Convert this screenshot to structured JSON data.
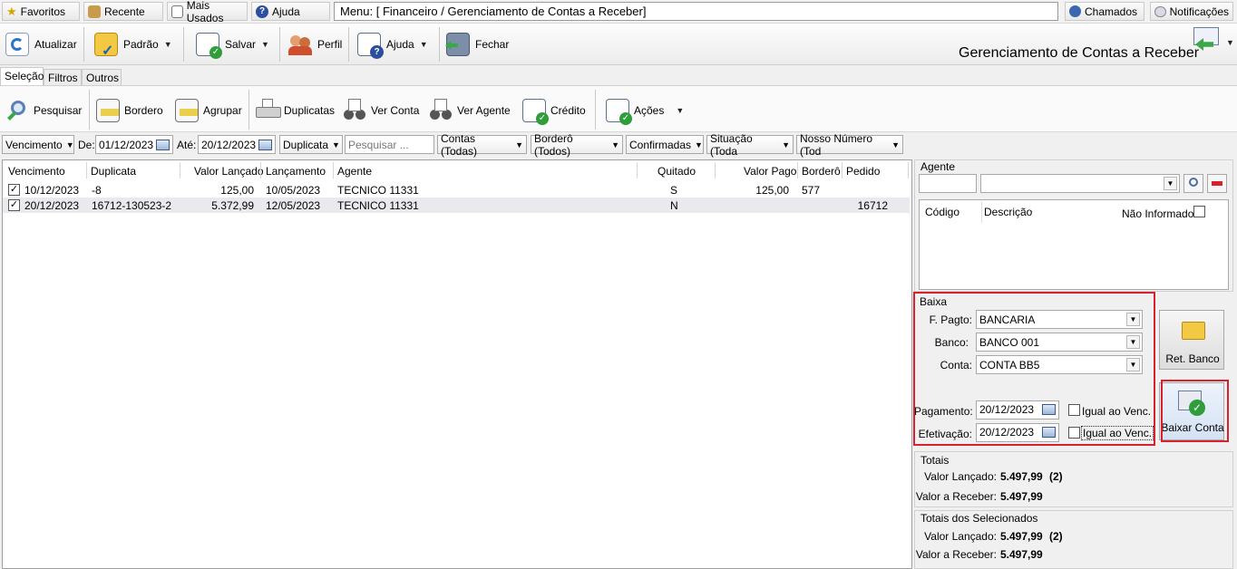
{
  "topbar": {
    "favoritos": "Favoritos",
    "recente": "Recente",
    "mais_usados": "Mais Usados",
    "ajuda": "Ajuda",
    "menu": "Menu: [ Financeiro / Gerenciamento de Contas a Receber]",
    "chamados": "Chamados",
    "notificacoes": "Notificações"
  },
  "toolbar": {
    "atualizar": "Atualizar",
    "padrao": "Padrão",
    "salvar": "Salvar",
    "perfil": "Perfil",
    "ajuda": "Ajuda",
    "fechar": "Fechar",
    "title": "Gerenciamento de Contas a Receber"
  },
  "tabs": [
    "Seleção",
    "Filtros",
    "Outros"
  ],
  "selection_toolbar": {
    "pesquisar": "Pesquisar",
    "bordero": "Bordero",
    "agrupar": "Agrupar",
    "duplicatas": "Duplicatas",
    "ver_conta": "Ver Conta",
    "ver_agente": "Ver Agente",
    "credito": "Crédito",
    "acoes": "Ações"
  },
  "filters": {
    "date_field": "Vencimento",
    "de_label": "De:",
    "de_value": "01/12/2023",
    "ate_label": "Até:",
    "ate_value": "20/12/2023",
    "doc_type": "Duplicata",
    "search_placeholder": "Pesquisar ...",
    "contas": "Contas (Todas)",
    "bordero": "Borderô (Todos)",
    "confirmadas": "Confirmadas",
    "situacao": "Situação (Toda",
    "nosso_numero": "Nosso Número (Tod"
  },
  "grid": {
    "columns": [
      "Vencimento",
      "Duplicata",
      "Valor Lançado",
      "Lançamento",
      "Agente",
      "Quitado",
      "Valor Pago",
      "Borderô",
      "Pedido"
    ],
    "rows": [
      {
        "vencimento": "10/12/2023",
        "duplicata": "-8",
        "valor_lancado": "125,00",
        "lancamento": "10/05/2023",
        "agente": "TECNICO 11331",
        "quitado": "S",
        "valor_pago": "125,00",
        "bordero": "577",
        "pedido": "",
        "checked": true
      },
      {
        "vencimento": "20/12/2023",
        "duplicata": "16712-130523-2",
        "valor_lancado": "5.372,99",
        "lancamento": "12/05/2023",
        "agente": "TECNICO 11331",
        "quitado": "N",
        "valor_pago": "",
        "bordero": "",
        "pedido": "16712",
        "checked": true
      }
    ]
  },
  "agente": {
    "title": "Agente",
    "codigo_header": "Código",
    "descricao_header": "Descrição",
    "nao_informado": "Não Informado"
  },
  "baixa": {
    "title": "Baixa",
    "f_pagto_label": "F. Pagto:",
    "f_pagto_value": "BANCARIA",
    "banco_label": "Banco:",
    "banco_value": "BANCO 001",
    "conta_label": "Conta:",
    "conta_value": "CONTA BB5",
    "pagamento_label": "Pagamento:",
    "pagamento_value": "20/12/2023",
    "efetivacao_label": "Efetivação:",
    "efetivacao_value": "20/12/2023",
    "igual_venc": "Igual ao Venc.",
    "ret_banco": "Ret. Banco",
    "baixar_conta": "Baixar Conta"
  },
  "totais": {
    "title": "Totais",
    "valor_lancado_label": "Valor Lançado:",
    "valor_lancado": "5.497,99",
    "valor_lancado_count": "(2)",
    "valor_receber_label": "Valor a Receber:",
    "valor_receber": "5.497,99"
  },
  "totais_selecionados": {
    "title": "Totais dos Selecionados",
    "valor_lancado_label": "Valor Lançado:",
    "valor_lancado": "5.497,99",
    "valor_lancado_count": "(2)",
    "valor_receber_label": "Valor a Receber:",
    "valor_receber": "5.497,99"
  },
  "colors": {
    "highlight_red": "#d8212c",
    "row_selected": "#e9e9ee"
  }
}
